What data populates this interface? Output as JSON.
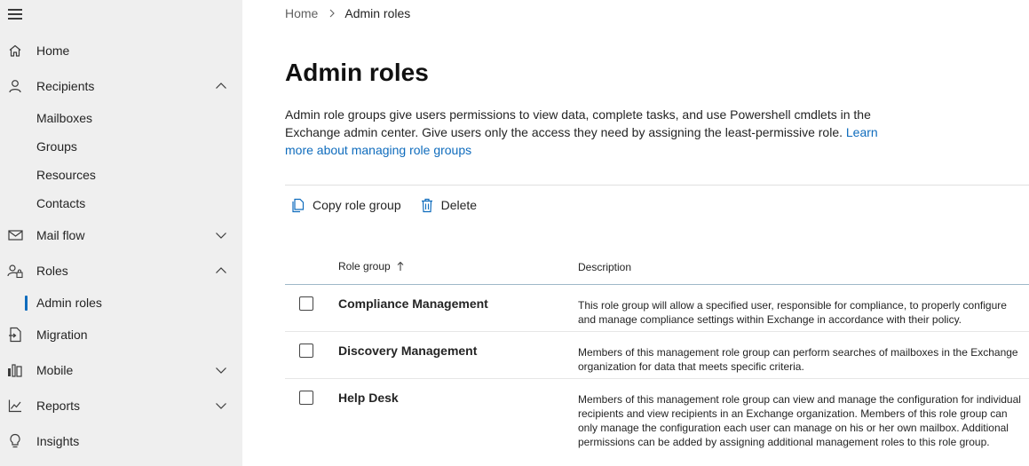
{
  "sidebar": {
    "items": [
      {
        "label": "Home",
        "icon": "home-icon"
      },
      {
        "label": "Recipients",
        "icon": "person-icon",
        "expanded": true,
        "children": [
          "Mailboxes",
          "Groups",
          "Resources",
          "Contacts"
        ]
      },
      {
        "label": "Mail flow",
        "icon": "mail-icon",
        "expanded": false
      },
      {
        "label": "Roles",
        "icon": "roles-icon",
        "expanded": true,
        "children": [
          "Admin roles"
        ]
      },
      {
        "label": "Migration",
        "icon": "migration-icon"
      },
      {
        "label": "Mobile",
        "icon": "mobile-icon",
        "expanded": false
      },
      {
        "label": "Reports",
        "icon": "chart-icon",
        "expanded": false
      },
      {
        "label": "Insights",
        "icon": "lightbulb-icon"
      }
    ],
    "active_item": "Admin roles"
  },
  "breadcrumb": {
    "home": "Home",
    "current": "Admin roles"
  },
  "page": {
    "title": "Admin roles",
    "description": "Admin role groups give users permissions to view data, complete tasks, and use Powershell cmdlets in the Exchange admin center. Give users only the access they need by assigning the least-permissive role.",
    "learn_more": "Learn more about managing role groups"
  },
  "toolbar": {
    "copy_label": "Copy role group",
    "delete_label": "Delete"
  },
  "table": {
    "columns": {
      "role_group": "Role group",
      "description": "Description"
    },
    "sort": "ascending",
    "rows": [
      {
        "name": "Compliance Management",
        "description": "This role group will allow a specified user, responsible for compliance, to properly configure and manage compliance settings within Exchange in accordance with their policy."
      },
      {
        "name": "Discovery Management",
        "description": "Members of this management role group can perform searches of mailboxes in the Exchange organization for data that meets specific criteria."
      },
      {
        "name": "Help Desk",
        "description": "Members of this management role group can view and manage the configuration for individual recipients and view recipients in an Exchange organization. Members of this role group can only manage the configuration each user can manage on his or her own mailbox. Additional permissions can be added by assigning additional management roles to this role group."
      }
    ]
  },
  "colors": {
    "accent": "#0f6cbd",
    "sidebar_bg": "#efefef"
  }
}
